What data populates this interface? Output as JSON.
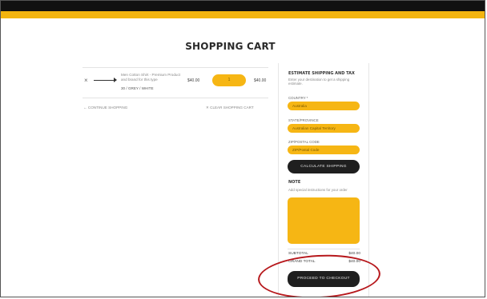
{
  "cart": {
    "title": "SHOPPING CART",
    "item": {
      "remove": "×",
      "name": "Men Cotton Shirt - Premium Product and brand for this type",
      "variant": "30 / GREY / WHITE",
      "price": "$40.00",
      "quantity": "1",
      "total": "$40.00"
    },
    "continue_link": "← CONTINUE SHOPPING",
    "clear_link": "✕ CLEAR SHOPPING CART"
  },
  "sidebar": {
    "heading": "ESTIMATE SHIPPING AND TAX",
    "intro": "Enter your destination to get a shipping estimate.",
    "country_label": "COUNTRY *",
    "country_value": "Australia",
    "state_label": "STATE/PROVINCE",
    "state_value": "Australian Capital Territory",
    "zip_label": "ZIP/POSTAL CODE",
    "zip_value": "ZIP/Postal Code",
    "calc_button": "CALCULATE SHIPPING",
    "note_heading": "NOTE",
    "note_hint": "Add special instructions for your order",
    "subtotal_label": "SUBTOTAL",
    "subtotal_value": "$40.00",
    "grand_total_label": "GRAND TOTAL",
    "grand_total_value": "$40.00",
    "checkout_button": "PROCEED TO CHECKOUT"
  },
  "colors": {
    "accent": "#f3b40f",
    "dark": "#1f1f1f",
    "annotation": "#b7191d"
  },
  "icons": {
    "remove": "close-icon"
  }
}
